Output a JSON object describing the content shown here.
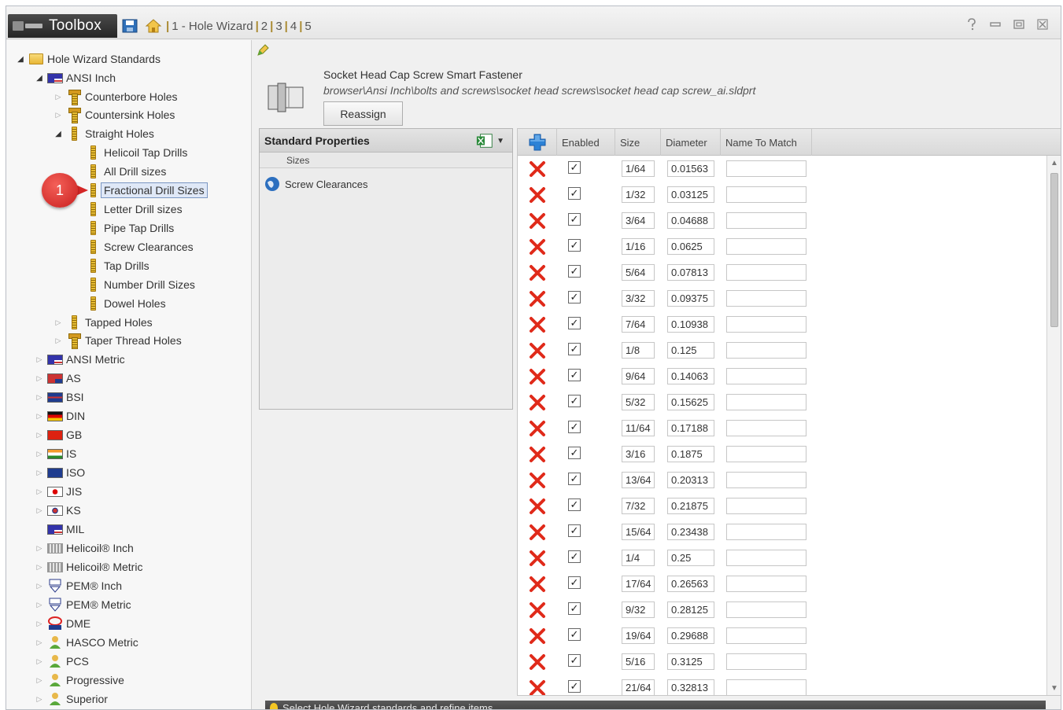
{
  "titlebar": {
    "toolbox_label": "Toolbox",
    "page_items": [
      "1 - Hole Wizard",
      "2",
      "3",
      "4",
      "5"
    ]
  },
  "tree": {
    "root": "Hole Wizard Standards",
    "ansi_inch": "ANSI Inch",
    "counterbore": "Counterbore Holes",
    "countersink": "Countersink Holes",
    "straight": "Straight Holes",
    "straight_children": [
      "Helicoil Tap Drills",
      "All Drill sizes",
      "Fractional Drill Sizes",
      "Letter Drill sizes",
      "Pipe Tap Drills",
      "Screw Clearances",
      "Tap Drills",
      "Number Drill Sizes",
      "Dowel Holes"
    ],
    "tapped": "Tapped Holes",
    "taper": "Taper Thread Holes",
    "standards": [
      "ANSI Metric",
      "AS",
      "BSI",
      "DIN",
      "GB",
      "IS",
      "ISO",
      "JIS",
      "KS",
      "MIL",
      "Helicoil® Inch",
      "Helicoil® Metric",
      "PEM® Inch",
      "PEM® Metric",
      "DME",
      "HASCO Metric",
      "PCS",
      "Progressive",
      "Superior"
    ]
  },
  "callout": "1",
  "header": {
    "name": "Socket Head Cap Screw Smart Fastener",
    "path": "browser\\Ansi Inch\\bolts and screws\\socket head screws\\socket head cap screw_ai.sldprt",
    "reassign_label": "Reassign"
  },
  "standard_properties": {
    "title": "Standard Properties",
    "sub_header": "Sizes",
    "items": [
      "Screw Clearances"
    ]
  },
  "grid": {
    "columns": [
      "Enabled",
      "Size",
      "Diameter",
      "Name To Match"
    ],
    "rows": [
      {
        "enabled": "✓",
        "size": "1/64",
        "diameter": "0.01563",
        "name": ""
      },
      {
        "enabled": "✓",
        "size": "1/32",
        "diameter": "0.03125",
        "name": ""
      },
      {
        "enabled": "✓",
        "size": "3/64",
        "diameter": "0.04688",
        "name": ""
      },
      {
        "enabled": "✓",
        "size": "1/16",
        "diameter": "0.0625",
        "name": ""
      },
      {
        "enabled": "✓",
        "size": "5/64",
        "diameter": "0.07813",
        "name": ""
      },
      {
        "enabled": "✓",
        "size": "3/32",
        "diameter": "0.09375",
        "name": ""
      },
      {
        "enabled": "✓",
        "size": "7/64",
        "diameter": "0.10938",
        "name": ""
      },
      {
        "enabled": "✓",
        "size": "1/8",
        "diameter": "0.125",
        "name": ""
      },
      {
        "enabled": "✓",
        "size": "9/64",
        "diameter": "0.14063",
        "name": ""
      },
      {
        "enabled": "✓",
        "size": "5/32",
        "diameter": "0.15625",
        "name": ""
      },
      {
        "enabled": "✓",
        "size": "11/64",
        "diameter": "0.17188",
        "name": ""
      },
      {
        "enabled": "✓",
        "size": "3/16",
        "diameter": "0.1875",
        "name": ""
      },
      {
        "enabled": "✓",
        "size": "13/64",
        "diameter": "0.20313",
        "name": ""
      },
      {
        "enabled": "✓",
        "size": "7/32",
        "diameter": "0.21875",
        "name": ""
      },
      {
        "enabled": "✓",
        "size": "15/64",
        "diameter": "0.23438",
        "name": ""
      },
      {
        "enabled": "✓",
        "size": "1/4",
        "diameter": "0.25",
        "name": ""
      },
      {
        "enabled": "✓",
        "size": "17/64",
        "diameter": "0.26563",
        "name": ""
      },
      {
        "enabled": "✓",
        "size": "9/32",
        "diameter": "0.28125",
        "name": ""
      },
      {
        "enabled": "✓",
        "size": "19/64",
        "diameter": "0.29688",
        "name": ""
      },
      {
        "enabled": "✓",
        "size": "5/16",
        "diameter": "0.3125",
        "name": ""
      },
      {
        "enabled": "✓",
        "size": "21/64",
        "diameter": "0.32813",
        "name": ""
      }
    ]
  },
  "status": "Select Hole Wizard standards and refine items.",
  "colors": {
    "delete_icon": "#e02a1a",
    "add_icon": "#2c82d6",
    "selection_border": "#7a96c2",
    "callout": "#d42626"
  }
}
